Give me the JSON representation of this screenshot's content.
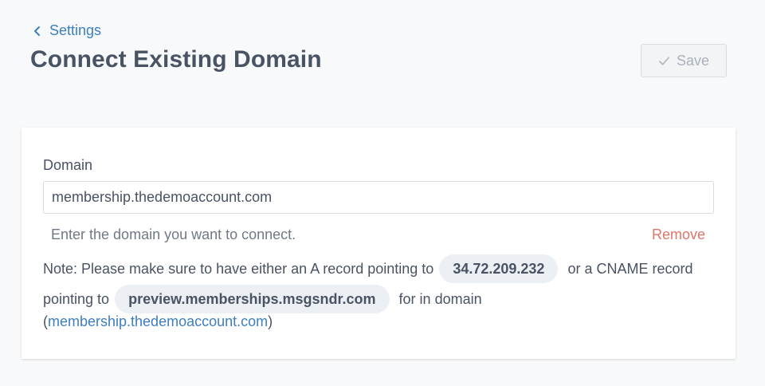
{
  "breadcrumb": {
    "label": "Settings"
  },
  "page": {
    "title": "Connect Existing Domain"
  },
  "toolbar": {
    "save_label": "Save"
  },
  "form": {
    "domain_label": "Domain",
    "domain_value": "membership.thedemoaccount.com",
    "help_text": "Enter the domain you want to connect.",
    "remove_label": "Remove"
  },
  "note": {
    "part1": "Note: Please make sure to have either an A record pointing to",
    "a_record": "34.72.209.232",
    "part2": "or a CNAME record pointing to",
    "cname": "preview.memberships.msgsndr.com",
    "part3": "for in domain",
    "open_paren": "(",
    "domain_link": "membership.thedemoaccount.com",
    "close_paren": ")"
  },
  "colors": {
    "link": "#3d7ec2",
    "remove": "#e0756a",
    "title": "#4a5364",
    "disabled": "#a9b0b9"
  },
  "icons": {
    "back": "chevron-left-icon",
    "save": "check-icon"
  }
}
